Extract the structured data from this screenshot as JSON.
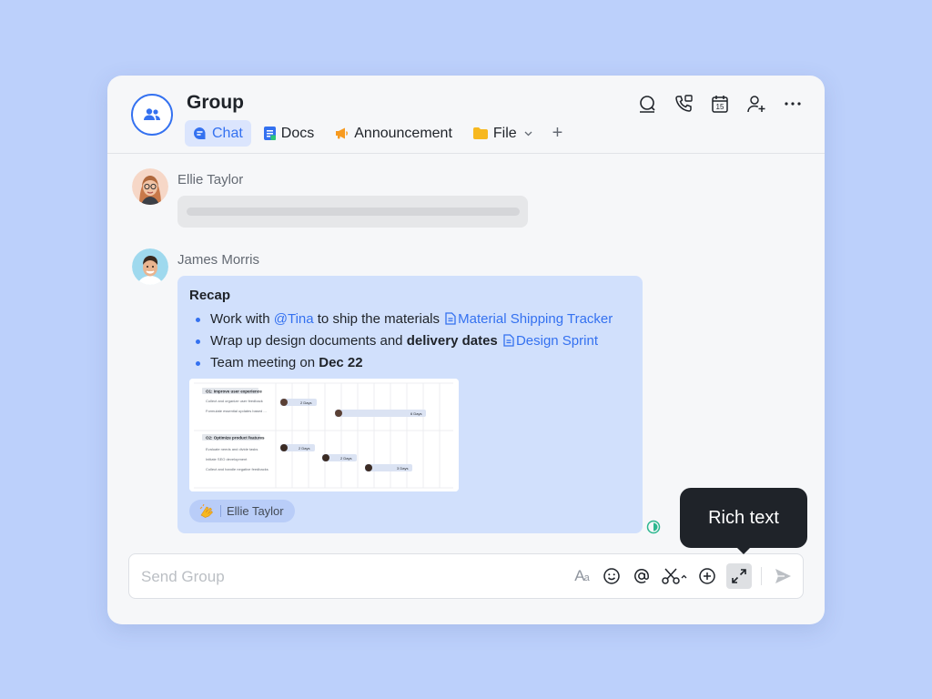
{
  "header": {
    "title": "Group",
    "tabs": [
      {
        "label": "Chat",
        "icon": "chat-bubble-icon",
        "active": true
      },
      {
        "label": "Docs",
        "icon": "docs-icon"
      },
      {
        "label": "Announcement",
        "icon": "megaphone-icon"
      },
      {
        "label": "File",
        "icon": "folder-icon",
        "has_dropdown": true
      }
    ],
    "add_tab": "+",
    "actions": [
      "search-icon",
      "call-icon",
      "calendar-icon",
      "add-member-icon",
      "more-icon"
    ],
    "calendar_day": "15"
  },
  "messages": [
    {
      "sender": "Ellie Taylor",
      "avatar": "ellie-avatar"
    },
    {
      "sender": "James Morris",
      "avatar": "james-avatar",
      "recap_title": "Recap",
      "bullets": [
        {
          "prefix": "Work with ",
          "mention": "@Tina",
          "middle": " to ship the materials ",
          "doc": "Material Shipping Tracker"
        },
        {
          "prefix": "Wrap up design documents and ",
          "bold": "delivery dates",
          "doc": "Design Sprint"
        },
        {
          "prefix": "Team meeting on ",
          "bold": "Dec 22"
        }
      ],
      "preview": {
        "groups": [
          {
            "title": "O1: Improve user experience",
            "tasks": [
              "Collect and organize user feedback",
              "Formulate essential updates based ..."
            ],
            "bars": [
              "2 Days",
              "6 Days"
            ]
          },
          {
            "title": "O2: Optimize product features",
            "tasks": [
              "Evaluate needs and divide tasks",
              "Initiate SEO development",
              "Collect and handle negative feedbacks"
            ],
            "bars": [
              "2 Days",
              "2 Days",
              "3 Days"
            ]
          }
        ]
      },
      "reaction": {
        "emoji": "clapping-hands",
        "user": "Ellie Taylor"
      }
    }
  ],
  "composer": {
    "placeholder": "Send Group",
    "tools": [
      "text-format-icon",
      "emoji-icon",
      "mention-icon",
      "screenshot-icon",
      "add-icon",
      "expand-icon",
      "send-icon"
    ],
    "text_format_label": "A",
    "text_format_sub": "a"
  },
  "tooltip": {
    "text": "Rich text"
  },
  "colors": {
    "accent": "#3471f0",
    "background": "#bcd0fb",
    "bubble": "#d1e0fc",
    "tooltip": "#1f2329"
  }
}
